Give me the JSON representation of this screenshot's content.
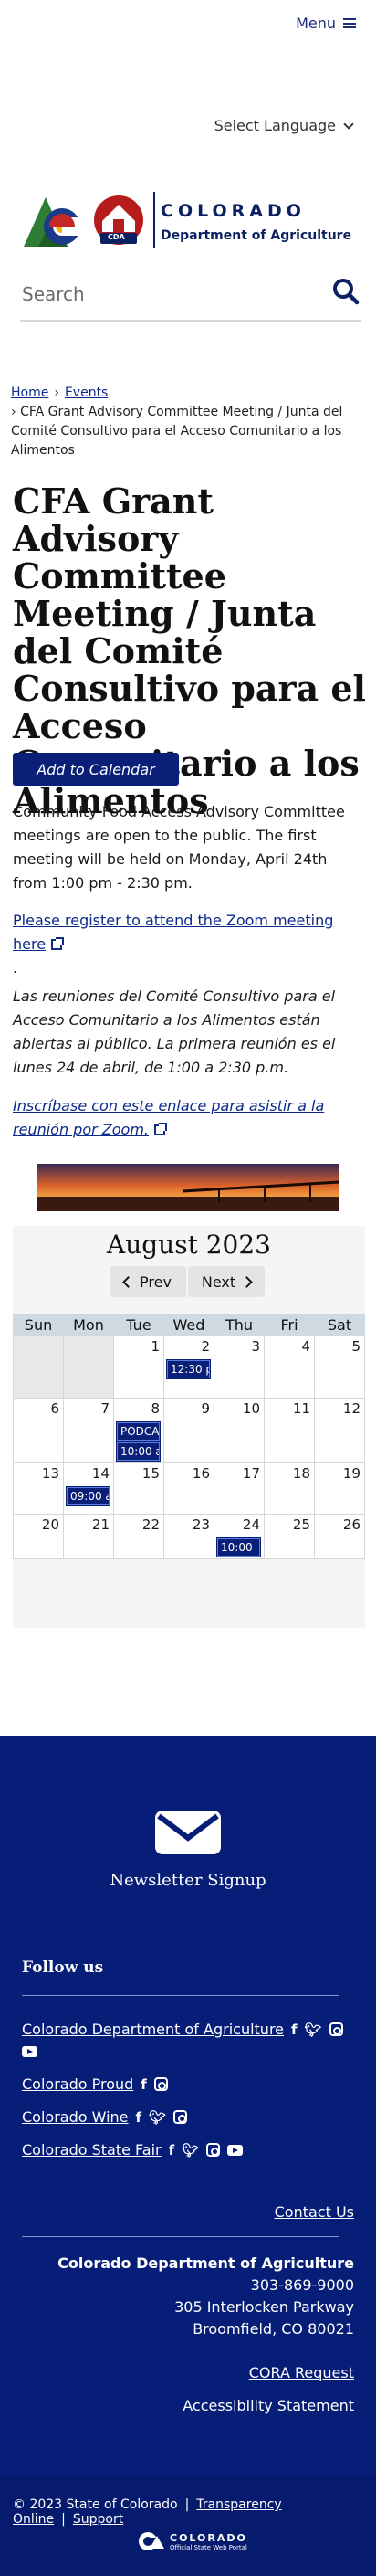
{
  "header": {
    "menu_label": "Menu",
    "language_label": "Select Language",
    "logo": {
      "line1": "COLORADO",
      "line2": "Department of Agriculture",
      "badge": "CDA"
    },
    "search_placeholder": "Search"
  },
  "breadcrumb": {
    "home": "Home",
    "events": "Events",
    "current": "CFA Grant Advisory Committee Meeting / Junta del Comité Consultivo para el Acceso Comunitario a los Alimentos"
  },
  "event": {
    "title": "CFA Grant Advisory Committee Meeting / Junta del Comité Consultivo para el Acceso Comunitario a los Alimentos",
    "add_to_calendar": "Add to Calendar",
    "description_en": "Community Food Access Advisory Committee meetings are open to the public. The first meeting will be held on Monday, April 24th from 1:00 pm - 2:30 pm.",
    "register_en": "Please register to attend the Zoom meeting here",
    "register_en_trailer": ".",
    "description_es": "Las reuniones del Comité Consultivo para el Acceso Comunitario a los Alimentos están abiertas al público. La primera reunión es el lunes 24 de abril, de 1:00 a 2:30 p.m.",
    "register_es": "Inscríbase con este enlace para asistir a la reunión por Zoom."
  },
  "calendar": {
    "month_label": "August 2023",
    "prev_label": "Prev",
    "next_label": "Next",
    "weekdays": [
      "Sun",
      "Mon",
      "Tue",
      "Wed",
      "Thu",
      "Fri",
      "Sat"
    ],
    "weeks": [
      [
        {
          "day": "",
          "other": true
        },
        {
          "day": "",
          "other": true
        },
        {
          "day": "1"
        },
        {
          "day": "2",
          "event": "12:30 p"
        },
        {
          "day": "3"
        },
        {
          "day": "4"
        },
        {
          "day": "5"
        }
      ],
      [
        {
          "day": "6"
        },
        {
          "day": "7"
        },
        {
          "day": "8",
          "event": "PODCAS",
          "event2": "10:00 a"
        },
        {
          "day": "9"
        },
        {
          "day": "10"
        },
        {
          "day": "11"
        },
        {
          "day": "12"
        }
      ],
      [
        {
          "day": "13"
        },
        {
          "day": "14",
          "event": "09:00 a"
        },
        {
          "day": "15"
        },
        {
          "day": "16"
        },
        {
          "day": "17"
        },
        {
          "day": "18"
        },
        {
          "day": "19"
        }
      ],
      [
        {
          "day": "20"
        },
        {
          "day": "21"
        },
        {
          "day": "22"
        },
        {
          "day": "23"
        },
        {
          "day": "24",
          "event": "10:00"
        },
        {
          "day": "25"
        },
        {
          "day": "26"
        }
      ]
    ]
  },
  "footer": {
    "newsletter_label": "Newsletter Signup",
    "follow_label": "Follow us",
    "social": [
      {
        "name": "Colorado Department of Agriculture",
        "icons": [
          "facebook-icon",
          "twitter-icon",
          "instagram-icon",
          "youtube-icon"
        ]
      },
      {
        "name": "Colorado Proud",
        "icons": [
          "facebook-icon",
          "instagram-icon"
        ]
      },
      {
        "name": "Colorado Wine",
        "icons": [
          "facebook-icon",
          "twitter-icon",
          "instagram-icon"
        ]
      },
      {
        "name": "Colorado State Fair",
        "icons": [
          "facebook-icon",
          "twitter-icon",
          "instagram-icon",
          "youtube-icon"
        ]
      }
    ],
    "contact_label": "Contact Us",
    "org_name": "Colorado Department of Agriculture",
    "phone": "303-869-9000",
    "address1": "305 Interlocken Parkway",
    "address2": "Broomfield, CO 80021",
    "cora_label": "CORA Request",
    "accessibility_label": "Accessibility Statement",
    "copyright": "© 2023 State of Colorado",
    "transparency_label": "Transparency Online",
    "support_label": "Support",
    "portal_line1": "COLORADO",
    "portal_line2": "Official State Web Portal"
  }
}
